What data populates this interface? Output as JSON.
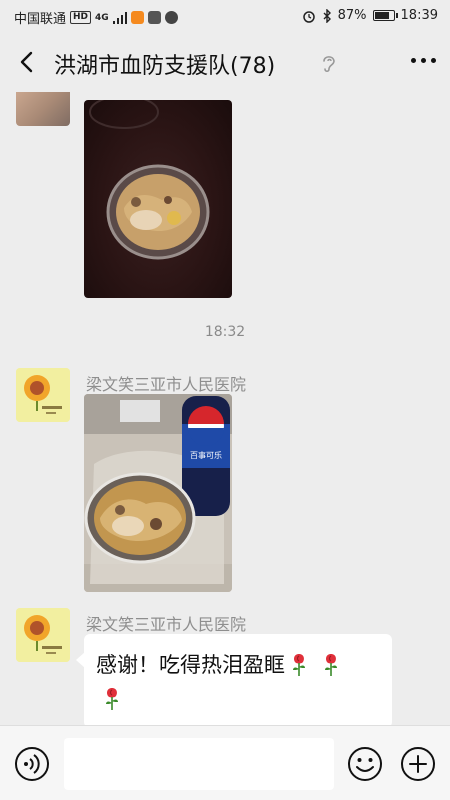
{
  "status_bar": {
    "carrier": "中国联通",
    "hd_badge": "HD",
    "network": "4G",
    "battery_percent": "87%",
    "battery_level": 0.87,
    "time": "18:39"
  },
  "header": {
    "title": "洪湖市血防支援队(78)",
    "icons": [
      "back-arrow-icon",
      "ear-icon",
      "more-icon"
    ]
  },
  "messages": [
    {
      "type": "image",
      "description_icon": "food-bowl-photo"
    },
    {
      "type": "time",
      "text": "18:32"
    },
    {
      "type": "image",
      "sender": "梁文笑三亚市人民医院",
      "bottle_label": "百事可乐"
    },
    {
      "type": "text",
      "sender": "梁文笑三亚市人民医院",
      "text": "感谢！吃得热泪盈眶",
      "emoji": [
        "rose-icon",
        "rose-icon",
        "rose-icon"
      ]
    }
  ],
  "input_bar": {
    "placeholder": "",
    "icons": [
      "voice-icon",
      "emoji-icon",
      "plus-icon"
    ]
  },
  "colors": {
    "background": "#ededed",
    "bubble": "#ffffff",
    "pepsi_blue": "#1f4aa8",
    "pepsi_red": "#d6262c"
  }
}
